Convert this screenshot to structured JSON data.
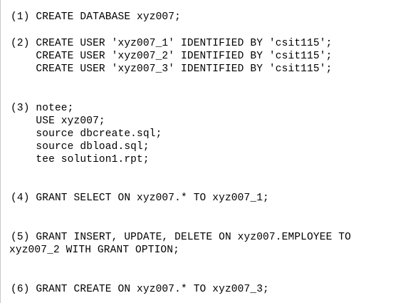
{
  "document": {
    "lines": [
      "(1) CREATE DATABASE xyz007;",
      "(2) CREATE USER 'xyz007_1' IDENTIFIED BY 'csit115';",
      "    CREATE USER 'xyz007_2' IDENTIFIED BY 'csit115';",
      "    CREATE USER 'xyz007_3' IDENTIFIED BY 'csit115';",
      "(3) notee;",
      "    USE xyz007;",
      "    source dbcreate.sql;",
      "    source dbload.sql;",
      "    tee solution1.rpt;",
      "(4) GRANT SELECT ON xyz007.* TO xyz007_1;",
      "(5) GRANT INSERT, UPDATE, DELETE ON xyz007.EMPLOYEE TO",
      "xyz007_2 WITH GRANT OPTION;",
      "(6) GRANT CREATE ON xyz007.* TO xyz007_3;"
    ]
  }
}
